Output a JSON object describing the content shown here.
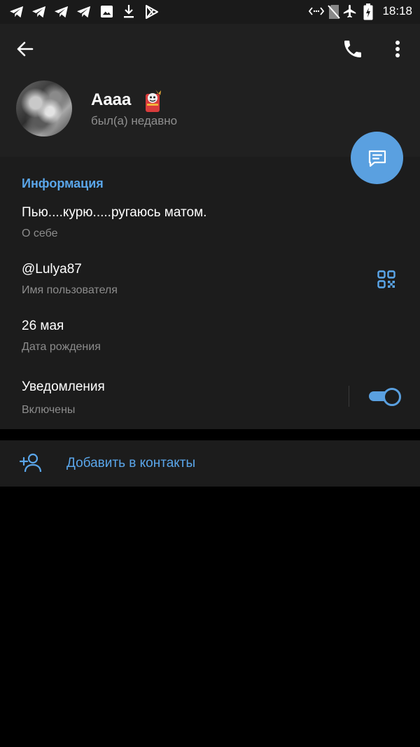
{
  "status_bar": {
    "time": "18:18",
    "left_icons": [
      "telegram-icon",
      "telegram-icon",
      "telegram-icon",
      "telegram-icon",
      "image-icon",
      "download-icon",
      "play-store-icon"
    ],
    "right_icons": [
      "data-saver-icon",
      "no-sim-icon",
      "airplane-icon",
      "battery-charging-icon"
    ]
  },
  "toolbar": {
    "back_icon": "arrow-left-icon",
    "call_icon": "phone-icon",
    "menu_icon": "more-vertical-icon"
  },
  "profile": {
    "name": "Aaaa",
    "status": "был(а) недавно",
    "message_fab_icon": "chat-icon"
  },
  "info": {
    "title": "Информация",
    "bio": "Пью....курю.....ругаюсь матом.",
    "bio_label": "О себе",
    "username": "@Lulya87",
    "username_label": "Имя пользователя",
    "birthday": "26 мая",
    "birthday_label": "Дата рождения",
    "notifications": "Уведомления",
    "notifications_status": "Включены",
    "notifications_enabled": true
  },
  "actions": {
    "add_contact": "Добавить в контакты"
  },
  "colors": {
    "accent": "#5aa6ea",
    "fab": "#5aa0e0",
    "header_bg": "#202020",
    "section_bg": "#1c1c1c"
  }
}
